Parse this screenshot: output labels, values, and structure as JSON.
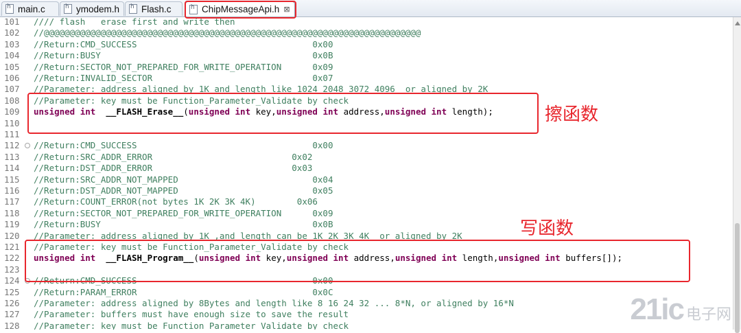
{
  "tabs": [
    {
      "label": "main.c",
      "active": false
    },
    {
      "label": "ymodem.h",
      "active": false
    },
    {
      "label": "Flash.c",
      "active": false
    },
    {
      "label": "ChipMessageApi.h",
      "active": true
    }
  ],
  "close_glyph": "⊠",
  "lines": [
    {
      "num": "101",
      "tokens": [
        {
          "t": "//// flash   erase first and write then",
          "c": "cmt"
        }
      ]
    },
    {
      "num": "102",
      "tokens": [
        {
          "t": "//@@@@@@@@@@@@@@@@@@@@@@@@@@@@@@@@@@@@@@@@@@@@@@@@@@@@@@@@@@@@@@@@@@@@@@@@@",
          "c": "cmt"
        }
      ]
    },
    {
      "num": "103",
      "tokens": [
        {
          "t": "//Return:CMD_SUCCESS                                  0x00",
          "c": "cmt"
        }
      ]
    },
    {
      "num": "104",
      "tokens": [
        {
          "t": "//Return:BUSY                                         0x0B",
          "c": "cmt"
        }
      ]
    },
    {
      "num": "105",
      "tokens": [
        {
          "t": "//Return:SECTOR_NOT_PREPARED_FOR_WRITE_OPERATION      0x09",
          "c": "cmt"
        }
      ]
    },
    {
      "num": "106",
      "tokens": [
        {
          "t": "//Return:INVALID_SECTOR                               0x07",
          "c": "cmt"
        }
      ]
    },
    {
      "num": "107",
      "tokens": [
        {
          "t": "//Parameter: address aligned by 1K and length like 1024 2048 3072 4096  or aligned by 2K",
          "c": "cmt"
        }
      ]
    },
    {
      "num": "108",
      "tokens": [
        {
          "t": "//Parameter: key must be Function_Parameter_Validate by check",
          "c": "cmt"
        }
      ]
    },
    {
      "num": "109",
      "tokens": [
        {
          "t": "unsigned int",
          "c": "kw"
        },
        {
          "t": "  ",
          "c": "tx"
        },
        {
          "t": "__FLASH_Erase__",
          "c": "fn"
        },
        {
          "t": "(",
          "c": "tx"
        },
        {
          "t": "unsigned int",
          "c": "kw"
        },
        {
          "t": " key,",
          "c": "tx"
        },
        {
          "t": "unsigned int",
          "c": "kw"
        },
        {
          "t": " address,",
          "c": "tx"
        },
        {
          "t": "unsigned int",
          "c": "kw"
        },
        {
          "t": " length);",
          "c": "tx"
        }
      ]
    },
    {
      "num": "110",
      "tokens": []
    },
    {
      "num": "111",
      "tokens": []
    },
    {
      "num": "112",
      "fold": true,
      "tokens": [
        {
          "t": "//Return:CMD_SUCCESS                                  0x00",
          "c": "cmt"
        }
      ]
    },
    {
      "num": "113",
      "tokens": [
        {
          "t": "//Return:SRC_ADDR_ERROR                           0x02",
          "c": "cmt"
        }
      ]
    },
    {
      "num": "114",
      "tokens": [
        {
          "t": "//Return:DST_ADDR_ERROR                           0x03",
          "c": "cmt"
        }
      ]
    },
    {
      "num": "115",
      "tokens": [
        {
          "t": "//Return:SRC_ADDR_NOT_MAPPED                          0x04",
          "c": "cmt"
        }
      ]
    },
    {
      "num": "116",
      "tokens": [
        {
          "t": "//Return:DST_ADDR_NOT_MAPPED                          0x05",
          "c": "cmt"
        }
      ]
    },
    {
      "num": "117",
      "tokens": [
        {
          "t": "//Return:COUNT_ERROR(not bytes 1K 2K 3K 4K)        0x06",
          "c": "cmt"
        }
      ]
    },
    {
      "num": "118",
      "tokens": [
        {
          "t": "//Return:SECTOR_NOT_PREPARED_FOR_WRITE_OPERATION      0x09",
          "c": "cmt"
        }
      ]
    },
    {
      "num": "119",
      "tokens": [
        {
          "t": "//Return:BUSY                                         0x0B",
          "c": "cmt"
        }
      ]
    },
    {
      "num": "120",
      "tokens": [
        {
          "t": "//Parameter: address aligned by 1K ,and length can be 1K 2K 3K 4K  or aligned by 2K",
          "c": "cmt"
        }
      ]
    },
    {
      "num": "121",
      "tokens": [
        {
          "t": "//Parameter: key must be Function_Parameter_Validate by check",
          "c": "cmt"
        }
      ]
    },
    {
      "num": "122",
      "tokens": [
        {
          "t": "unsigned int",
          "c": "kw"
        },
        {
          "t": "  ",
          "c": "tx"
        },
        {
          "t": "__FLASH_Program__",
          "c": "fn"
        },
        {
          "t": "(",
          "c": "tx"
        },
        {
          "t": "unsigned int",
          "c": "kw"
        },
        {
          "t": " key,",
          "c": "tx"
        },
        {
          "t": "unsigned int",
          "c": "kw"
        },
        {
          "t": " address,",
          "c": "tx"
        },
        {
          "t": "unsigned int",
          "c": "kw"
        },
        {
          "t": " length,",
          "c": "tx"
        },
        {
          "t": "unsigned int",
          "c": "kw"
        },
        {
          "t": " buffers[]);",
          "c": "tx"
        }
      ]
    },
    {
      "num": "123",
      "tokens": []
    },
    {
      "num": "124",
      "fold": true,
      "tokens": [
        {
          "t": "//Return:CMD_SUCCESS                                  0x00",
          "c": "cmt"
        }
      ]
    },
    {
      "num": "125",
      "tokens": [
        {
          "t": "//Return:PARAM_ERROR                                  0x0C",
          "c": "cmt"
        }
      ]
    },
    {
      "num": "126",
      "tokens": [
        {
          "t": "//Parameter: address aligned by 8Bytes and length like 8 16 24 32 ... 8*N, or aligned by 16*N",
          "c": "cmt"
        }
      ]
    },
    {
      "num": "127",
      "tokens": [
        {
          "t": "//Parameter: buffers must have enough size to save the result",
          "c": "cmt"
        }
      ]
    },
    {
      "num": "128",
      "tokens": [
        {
          "t": "//Parameter: key must be Function_Parameter_Validate by check",
          "c": "cmt"
        }
      ]
    }
  ],
  "annotations": {
    "erase": "擦函数",
    "write": "写函数"
  },
  "watermark": {
    "logo": "21ic",
    "cn": "电子网"
  },
  "colors": {
    "highlight_box": "#e8262d",
    "comment": "#3f7f5f",
    "keyword": "#7f0055",
    "line_number": "#787878"
  }
}
